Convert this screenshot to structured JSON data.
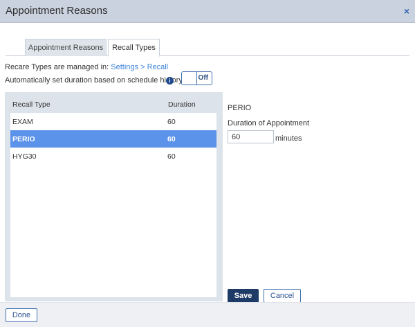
{
  "window": {
    "title": "Appointment Reasons",
    "close_icon": "×"
  },
  "tabs": [
    {
      "label": "Appointment Reasons",
      "active": false
    },
    {
      "label": "Recall Types",
      "active": true
    }
  ],
  "managed_line": {
    "prefix": "Recare Types are managed in: ",
    "link": "Settings > Recall"
  },
  "auto_duration": {
    "label": "Automatically set duration based on schedule history",
    "info_icon": "i",
    "toggle_state": "Off"
  },
  "list": {
    "columns": {
      "type": "Recall Type",
      "duration": "Duration"
    },
    "rows": [
      {
        "type": "EXAM",
        "duration": "60",
        "selected": false
      },
      {
        "type": "PERIO",
        "duration": "60",
        "selected": true
      },
      {
        "type": "HYG30",
        "duration": "60",
        "selected": false
      }
    ]
  },
  "detail": {
    "title": "PERIO",
    "duration_label": "Duration of Appointment",
    "duration_value": "60",
    "unit": "minutes"
  },
  "buttons": {
    "save": "Save",
    "cancel": "Cancel",
    "done": "Done"
  },
  "colors": {
    "accent": "#1e3a66",
    "selected_row": "#5b93ea",
    "link": "#3b82d8"
  }
}
